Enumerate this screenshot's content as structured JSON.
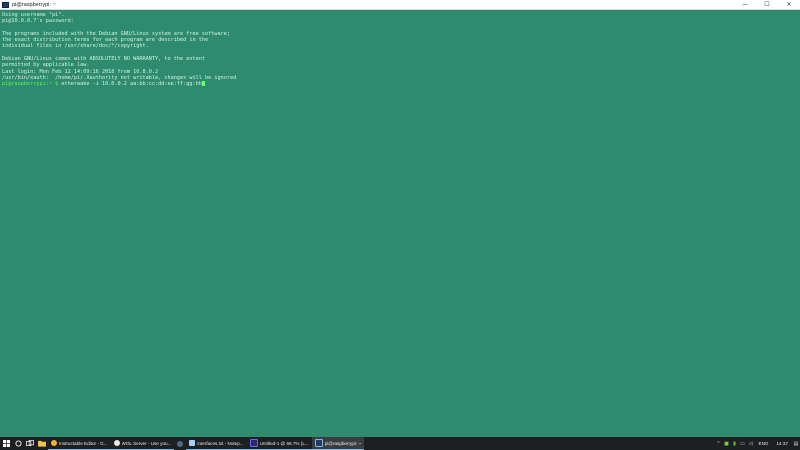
{
  "window": {
    "title": "pi@raspberrypi: ~",
    "minimize_glyph": "—",
    "maximize_glyph": "☐",
    "close_glyph": "✕"
  },
  "terminal": {
    "lines": [
      "Using username \"pi\".",
      "pi@10.0.0.7's password:",
      "",
      "The programs included with the Debian GNU/Linux system are free software;",
      "the exact distribution terms for each program are described in the",
      "individual files in /usr/share/doc/*/copyright.",
      "",
      "Debian GNU/Linux comes with ABSOLUTELY NO WARRANTY, to the extent",
      "permitted by applicable law.",
      "Last login: Mon Feb 12 14:09:16 2018 from 10.0.0.2",
      "/usr/bin/xauth:  /home/pi/.Xauthority not writable, changes will be ignored"
    ],
    "prompt": "pi@raspberrypi:~ $",
    "command": " etherwake -i 10.0.0.2 aa:bb:cc:dd:ee:ff:gg:hh"
  },
  "taskbar": {
    "apps": [
      {
        "label": "Instructable Editor - G...",
        "color": "#f2b233",
        "state": "open"
      },
      {
        "label": "WOL Server - Use you...",
        "color": "#e8e8e8",
        "state": "open"
      },
      {
        "label": "",
        "color": "#1b2838",
        "state": "icon"
      },
      {
        "label": "interfaces.txt - Notep...",
        "color": "#9fd2f5",
        "state": "open"
      },
      {
        "label": "Untitled-1 @ 66.7% (L...",
        "color": "#2a2a6a",
        "state": "open"
      },
      {
        "label": "pi@raspberrypi: ~",
        "color": "#1e3d6b",
        "state": "active"
      }
    ],
    "language": "ENG",
    "clock": "14:37"
  },
  "colors": {
    "terminal_bg": "#2e8b6e",
    "terminal_fg": "#d4f2e6",
    "prompt": "#5cf25c",
    "taskbar_bg": "#1d1f21",
    "accent": "#76b9ed"
  }
}
